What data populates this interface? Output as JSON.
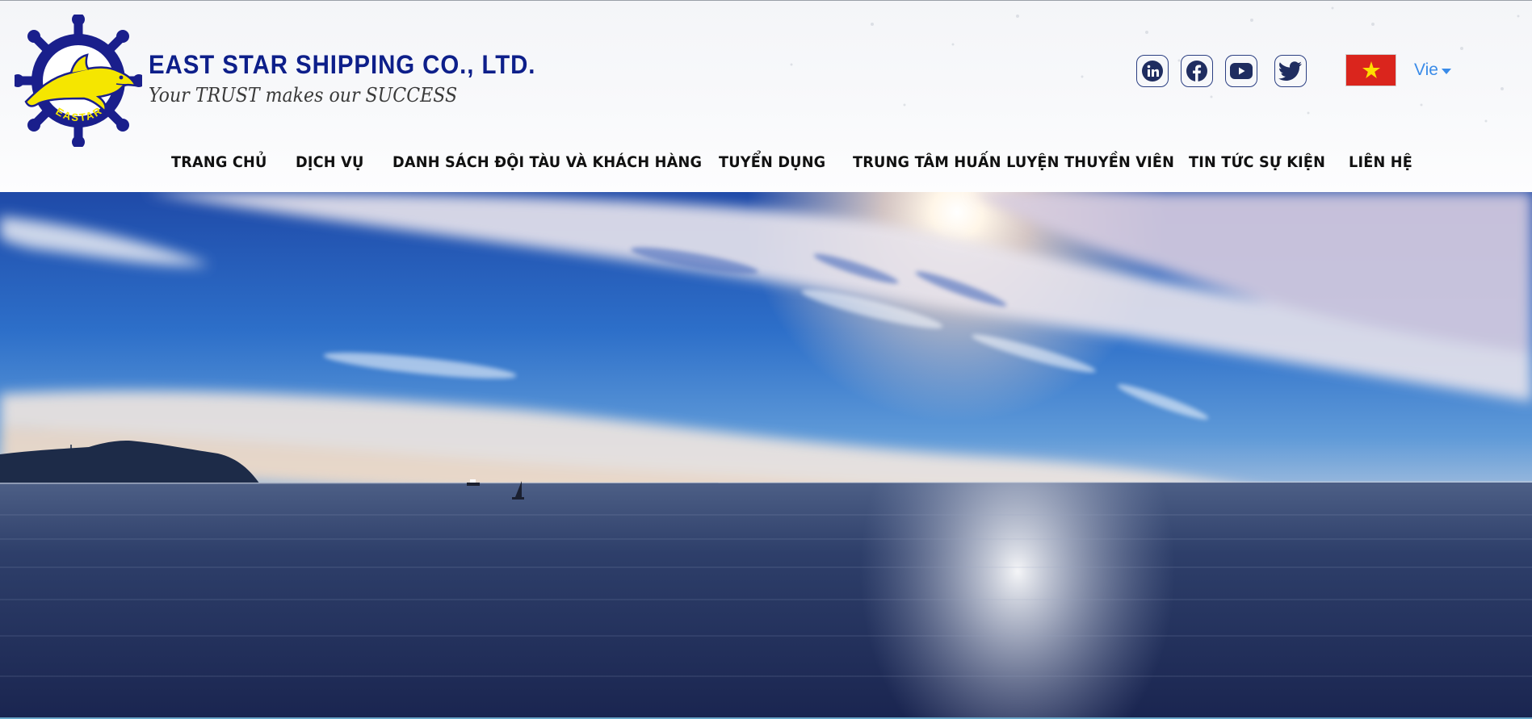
{
  "brand": {
    "logo_icon": "dolphin-ship-wheel-logo",
    "logo_ring_text": "EASTAR",
    "name": "EAST STAR SHIPPING CO., LTD.",
    "tagline": "Your TRUST makes our SUCCESS"
  },
  "social": [
    {
      "icon": "linkedin-icon"
    },
    {
      "icon": "facebook-icon"
    },
    {
      "icon": "youtube-icon"
    },
    {
      "icon": "twitter-icon"
    }
  ],
  "language": {
    "flag_icon": "vietnam-flag-icon",
    "label": "Vie"
  },
  "nav": {
    "items": [
      {
        "label": "TRANG CHỦ"
      },
      {
        "label": "DỊCH VỤ"
      },
      {
        "label": "DANH SÁCH ĐỘI TÀU VÀ KHÁCH HÀNG"
      },
      {
        "label": "TUYỂN DỤNG"
      },
      {
        "label": "TRUNG TÂM HUẤN LUYỆN THUYỀN VIÊN"
      },
      {
        "label": "TIN TỨC SỰ KIỆN"
      },
      {
        "label": "LIÊN HỆ"
      }
    ]
  },
  "hero": {
    "image": "ocean-sunset-banner"
  },
  "colors": {
    "brand_blue": "#0d1f8a",
    "logo_yellow": "#f5e600",
    "link_blue": "#3a8be8",
    "flag_red": "#da251d",
    "flag_star": "#ffde00"
  }
}
